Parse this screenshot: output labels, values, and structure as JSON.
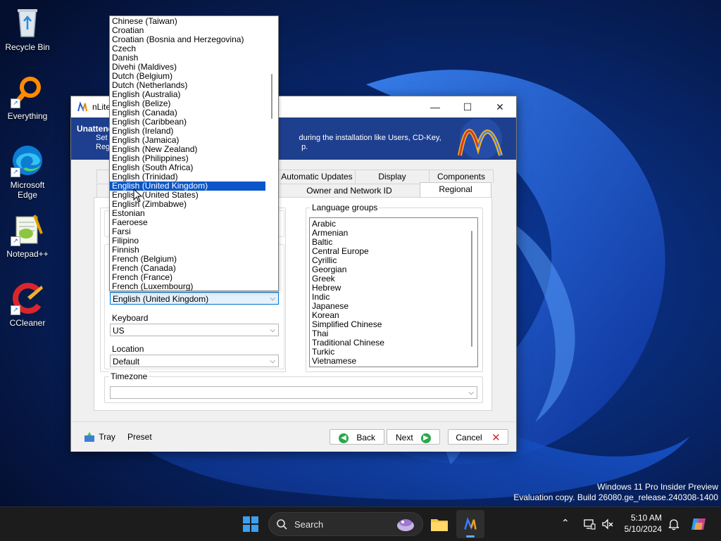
{
  "desktop": {
    "icons": [
      {
        "label": "Recycle Bin",
        "icon": "recycle-bin-icon"
      },
      {
        "label": "Everything",
        "icon": "everything-search-icon"
      },
      {
        "label": "Microsoft Edge",
        "icon": "edge-icon"
      },
      {
        "label": "Notepad++",
        "icon": "notepad-plus-plus-icon"
      },
      {
        "label": "CCleaner",
        "icon": "ccleaner-icon"
      }
    ],
    "watermark": {
      "line1": "Windows 11 Pro Insider Preview",
      "line2": "Evaluation copy. Build 26080.ge_release.240308-1400"
    }
  },
  "window": {
    "title": "nLite",
    "banner": {
      "title": "Unattended",
      "desc_line1": "Set                                                                                         during the installation like Users, CD-Key,",
      "desc_line2": "Reg                                                                                         p."
    },
    "tabs_row1": [
      "Automatic Updates",
      "Display",
      "Components"
    ],
    "tabs_row2": [
      "Owner and Network ID",
      "Regional"
    ],
    "active_tab": "Regional",
    "regional": {
      "locale_selected": "English (United Kingdom)",
      "keyboard_label": "Keyboard",
      "keyboard_value": "US",
      "location_label": "Location",
      "location_value": "Default",
      "timezone_label": "Timezone",
      "timezone_value": "",
      "language_groups_label": "Language groups",
      "language_groups": [
        "Arabic",
        "Armenian",
        "Baltic",
        "Central Europe",
        "Cyrillic",
        "Georgian",
        "Greek",
        "Hebrew",
        "Indic",
        "Japanese",
        "Korean",
        "Simplified Chinese",
        "Thai",
        "Traditional Chinese",
        "Turkic",
        "Vietnamese"
      ]
    },
    "dropdown_items": [
      "Chinese (Taiwan)",
      "Croatian",
      "Croatian (Bosnia and Herzegovina)",
      "Czech",
      "Danish",
      "Divehi (Maldives)",
      "Dutch (Belgium)",
      "Dutch (Netherlands)",
      "English (Australia)",
      "English (Belize)",
      "English (Canada)",
      "English (Caribbean)",
      "English (Ireland)",
      "English (Jamaica)",
      "English (New Zealand)",
      "English (Philippines)",
      "English (South Africa)",
      "English (Trinidad)",
      "English (United Kingdom)",
      "English (United States)",
      "English (Zimbabwe)",
      "Estonian",
      "Faeroese",
      "Farsi",
      "Filipino",
      "Finnish",
      "French (Belgium)",
      "French (Canada)",
      "French (France)",
      "French (Luxembourg)"
    ],
    "dropdown_selected_index": 18,
    "buttons": {
      "tray": "Tray",
      "preset": "Preset",
      "back": "Back",
      "next": "Next",
      "cancel": "Cancel"
    }
  },
  "taskbar": {
    "search_label": "Search",
    "time": "5:10 AM",
    "date": "5/10/2024"
  },
  "colors": {
    "selection": "#0a56c8",
    "banner": "#1e3f8e",
    "taskbar": "#1c1c1c"
  }
}
